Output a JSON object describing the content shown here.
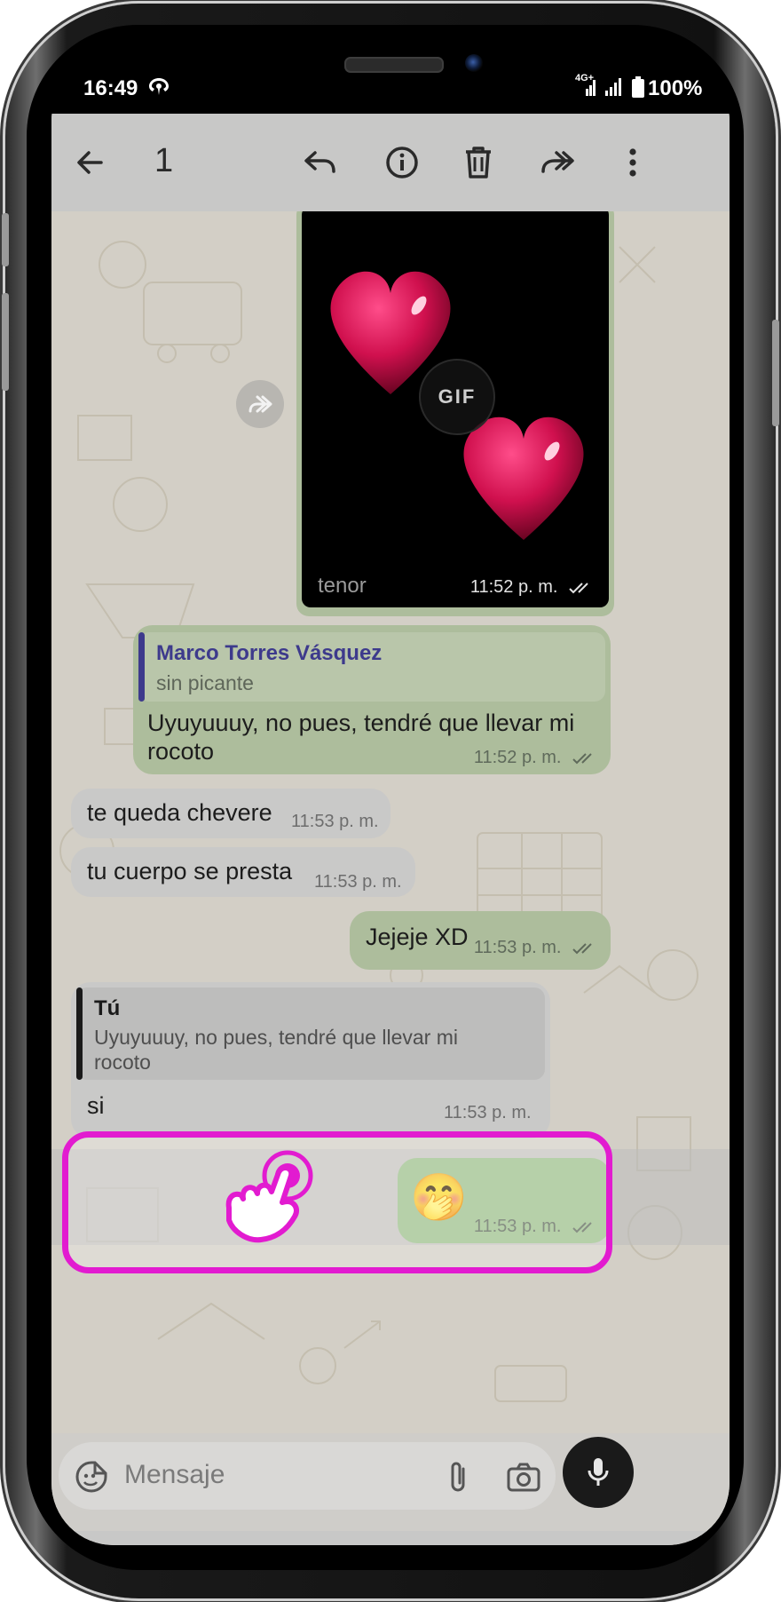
{
  "status_bar": {
    "time": "16:49",
    "network": "4G+",
    "battery": "100%"
  },
  "toolbar": {
    "selected_count": "1"
  },
  "messages": {
    "gif": {
      "watermark": "tenor",
      "badge": "GIF",
      "time": "11:52 p. m."
    },
    "reply1": {
      "quote_author": "Marco Torres Vásquez",
      "quote_text": "sin picante",
      "text": "Uyuyuuuy, no pues, tendré que llevar mi rocoto",
      "time": "11:52 p. m."
    },
    "in1": {
      "text": "te queda chevere",
      "time": "11:53 p. m."
    },
    "in2": {
      "text": "tu cuerpo se presta",
      "time": "11:53 p. m."
    },
    "out1": {
      "text": "Jejeje XD",
      "time": "11:53 p. m."
    },
    "reply2": {
      "quote_author": "Tú",
      "quote_text": "Uyuyuuuy, no pues, tendré que llevar mi rocoto",
      "text": "si",
      "time": "11:53 p. m."
    },
    "emoji_msg": {
      "emoji": "🤭",
      "time": "11:53 p. m."
    }
  },
  "input": {
    "placeholder": "Mensaje"
  },
  "colors": {
    "highlight": "#e21bd0",
    "quote_bar_contact": "#3d3a8c",
    "quote_bar_self": "#1a1a1a"
  }
}
